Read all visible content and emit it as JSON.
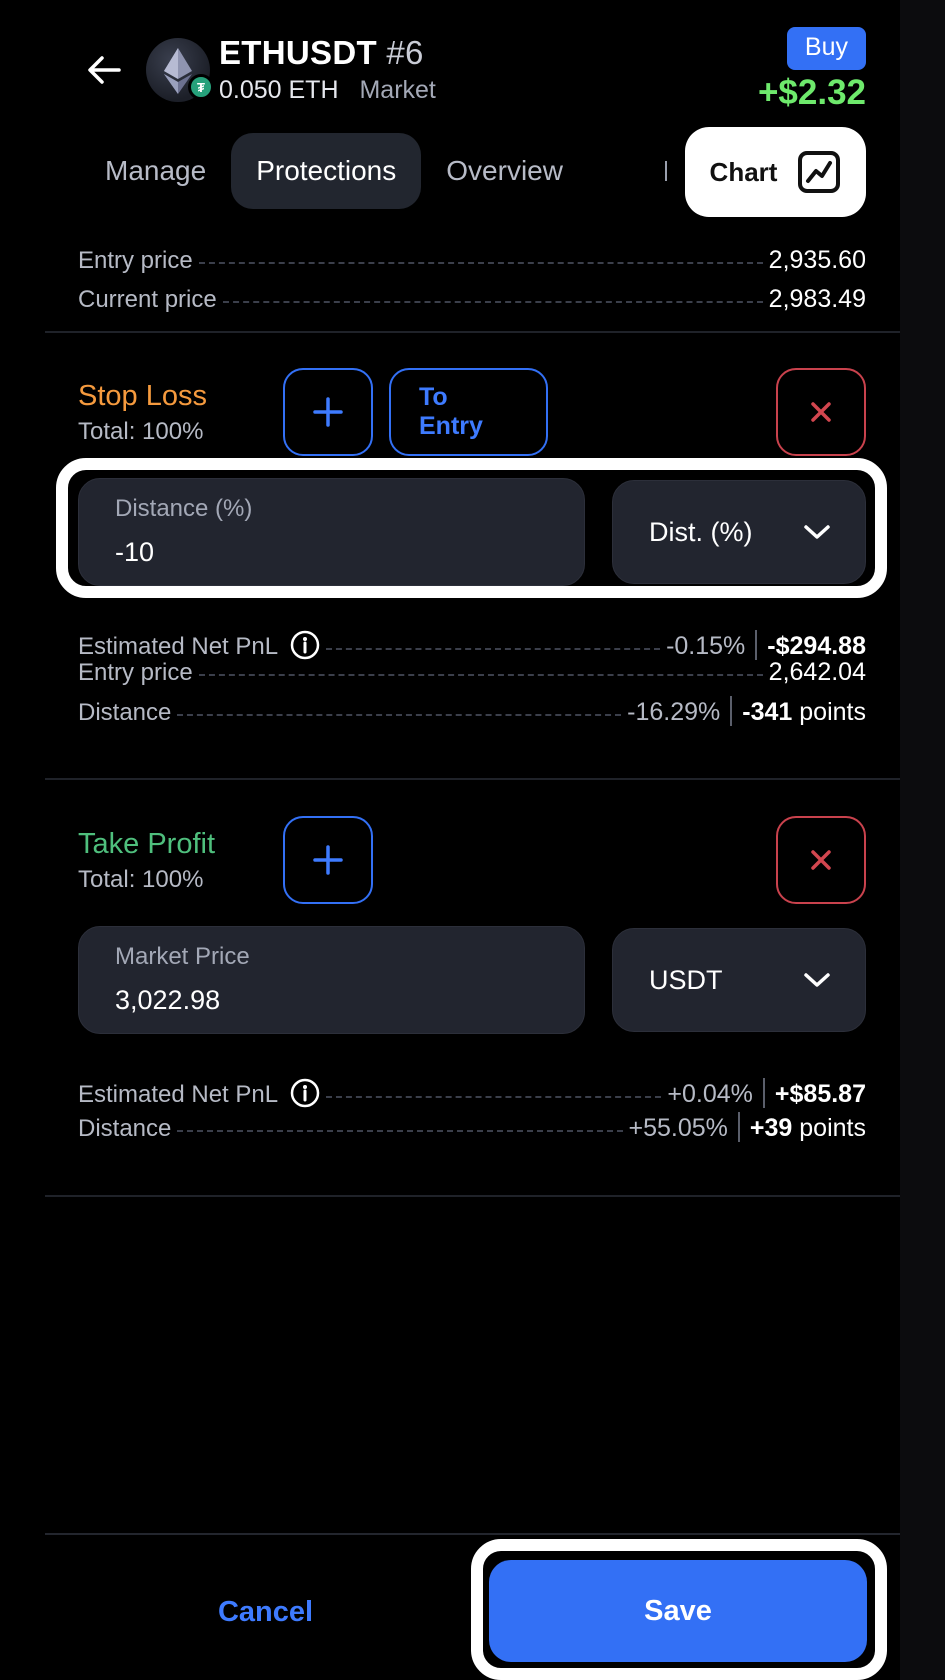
{
  "header": {
    "symbol": "ETHUSDT",
    "position_number": "#6",
    "quantity": "0.050 ETH",
    "order_type": "Market",
    "side": "Buy",
    "pnl": "+$2.32",
    "icons": {
      "back": "arrow-left-icon",
      "coin": "ethereum-icon",
      "quote_badge": "tether-icon"
    }
  },
  "tabs": [
    "Manage",
    "Protections",
    "Overview"
  ],
  "active_tab": "Protections",
  "chart_button": {
    "label": "Chart",
    "icon": "chart-line-icon"
  },
  "summary": [
    {
      "label": "Entry price",
      "value": "2,935.60"
    },
    {
      "label": "Current price",
      "value": "2,983.49"
    }
  ],
  "stop_loss": {
    "title": "Stop Loss",
    "total": "Total: 100%",
    "to_entry_label": "To Entry",
    "field_label": "Distance (%)",
    "field_value": "-10",
    "select_value": "Dist. (%)",
    "estimated_label": "Estimated Net PnL",
    "estimated_pct": "-0.15%",
    "estimated_amount": "-$294.88",
    "entry_label": "Entry price",
    "entry_value": "2,642.04",
    "distance_label": "Distance",
    "distance_pct": "-16.29%",
    "distance_points": "-341",
    "points_word": "points"
  },
  "take_profit": {
    "title": "Take Profit",
    "total": "Total: 100%",
    "field_label": "Market Price",
    "field_value": "3,022.98",
    "select_value": "USDT",
    "estimated_label": "Estimated Net PnL",
    "estimated_pct": "+0.04%",
    "estimated_amount": "+$85.87",
    "distance_label": "Distance",
    "distance_pct": "+55.05%",
    "distance_points": "+39",
    "points_word": "points"
  },
  "footer": {
    "cancel_label": "Cancel",
    "save_label": "Save"
  },
  "colors": {
    "accent": "#3370f5",
    "profit": "#6ee96c",
    "stop_loss": "#f59a3e",
    "take_profit": "#4fbf7d",
    "danger": "#c9424d"
  }
}
